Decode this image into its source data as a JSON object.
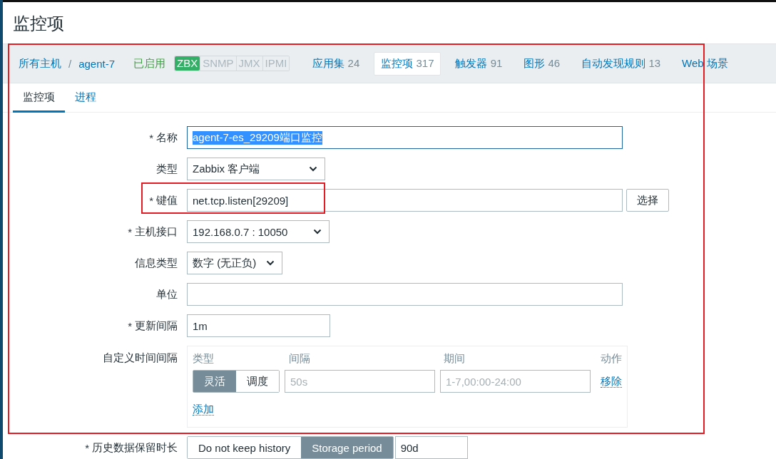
{
  "page_title": "监控项",
  "highlight_frame": true,
  "nav": {
    "breadcrumbs": [
      "所有主机",
      "agent-7"
    ],
    "separator": "/",
    "status": "已启用",
    "availability": [
      {
        "label": "ZBX",
        "on": true
      },
      {
        "label": "SNMP",
        "on": false
      },
      {
        "label": "JMX",
        "on": false
      },
      {
        "label": "IPMI",
        "on": false
      }
    ],
    "links": [
      {
        "label": "应用集",
        "count": "24",
        "selected": false
      },
      {
        "label": "监控项",
        "count": "317",
        "selected": true
      },
      {
        "label": "触发器",
        "count": "91",
        "selected": false
      },
      {
        "label": "图形",
        "count": "46",
        "selected": false
      },
      {
        "label": "自动发现规则",
        "count": "13",
        "selected": false
      },
      {
        "label": "Web 场景",
        "selected": false
      }
    ]
  },
  "tabs": [
    {
      "label": "监控项",
      "selected": true
    },
    {
      "label": "进程",
      "selected": false
    }
  ],
  "form": [
    {
      "kind": "text",
      "asterisk": "*",
      "label": "名称",
      "value": "agent-7-es_29209端口监控",
      "text_selected": true,
      "highlighted": false
    },
    {
      "kind": "select",
      "label": "类型",
      "value": "Zabbix 客户端",
      "highlighted": false
    },
    {
      "kind": "text_button",
      "asterisk": "*",
      "label": "键值",
      "value": "net.tcp.listen[29209]",
      "button": "选择",
      "highlighted": true
    },
    {
      "kind": "select",
      "asterisk": "*",
      "label": "主机接口",
      "value": "192.168.0.7 : 10050",
      "highlighted": false
    },
    {
      "kind": "select",
      "label": "信息类型",
      "value": "数字 (无正负)",
      "highlighted": false
    },
    {
      "kind": "text",
      "label": "单位",
      "highlighted": false
    },
    {
      "kind": "text",
      "asterisk": "*",
      "label": "更新间隔",
      "value": "1m",
      "highlighted": false
    },
    {
      "kind": "intervals",
      "label": "自定义时间间隔",
      "highlighted": false,
      "columns": [
        "类型",
        "间隔",
        "期间",
        "动作"
      ],
      "rows": [
        {
          "types": [
            {
              "label": "灵活",
              "selected": true
            },
            {
              "label": "调度",
              "selected": false
            }
          ],
          "interval_placeholder": "50s",
          "period_placeholder": "1-7,00:00-24:00",
          "action": "移除"
        }
      ],
      "add": "添加"
    },
    {
      "kind": "segmented",
      "asterisk": "*",
      "label": "历史数据保留时长",
      "highlighted": false,
      "options": [
        {
          "label": "Do not keep history",
          "selected": false
        },
        {
          "label": "Storage period",
          "selected": true
        }
      ],
      "value": "90d"
    }
  ]
}
